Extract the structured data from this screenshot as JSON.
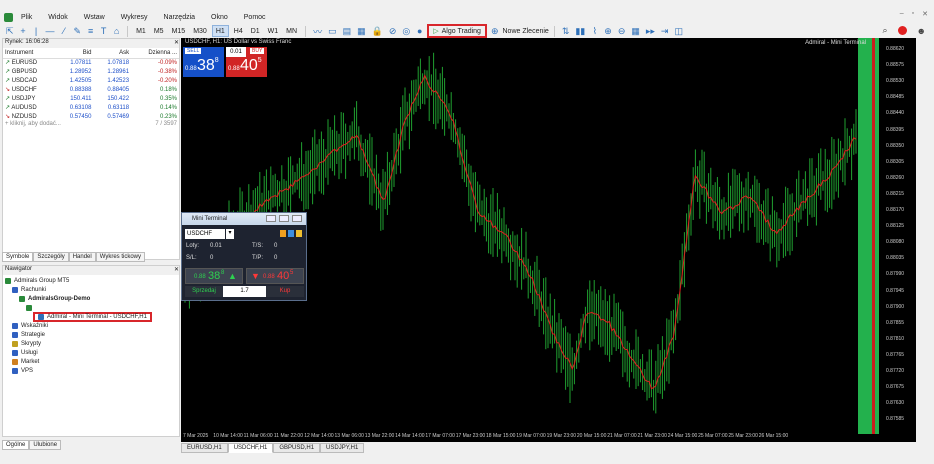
{
  "menu": [
    "Plik",
    "Widok",
    "Wstaw",
    "Wykresy",
    "Narzędzia",
    "Okno",
    "Pomoc"
  ],
  "window_controls": [
    "‒",
    "▫",
    "✕"
  ],
  "toolbar": {
    "timeframes": [
      "M1",
      "M5",
      "M15",
      "M30",
      "H1",
      "H4",
      "D1",
      "W1",
      "MN"
    ],
    "active_tf": "H1",
    "algo_label": "Algo Trading",
    "new_order_label": "Nowe Zlecenie"
  },
  "market_watch": {
    "title": "Rynek: 16:06:28",
    "columns": [
      "Instrument",
      "Bid",
      "Ask",
      "Dzienna ..."
    ],
    "rows": [
      {
        "symbol": "EURUSD",
        "bid": "1.07811",
        "ask": "1.07818",
        "change": "-0.09%",
        "dir": "up"
      },
      {
        "symbol": "GBPUSD",
        "bid": "1.28952",
        "ask": "1.28961",
        "change": "-0.38%",
        "dir": "up"
      },
      {
        "symbol": "USDCAD",
        "bid": "1.42505",
        "ask": "1.42523",
        "change": "-0.20%",
        "dir": "up"
      },
      {
        "symbol": "USDCHF",
        "bid": "0.88388",
        "ask": "0.88405",
        "change": "0.18%",
        "dir": "dn"
      },
      {
        "symbol": "USDJPY",
        "bid": "150.411",
        "ask": "150.422",
        "change": "0.35%",
        "dir": "up"
      },
      {
        "symbol": "AUDUSD",
        "bid": "0.63108",
        "ask": "0.63118",
        "change": "0.14%",
        "dir": "up"
      },
      {
        "symbol": "NZDUSD",
        "bid": "0.57450",
        "ask": "0.57469",
        "change": "0.23%",
        "dir": "dn"
      }
    ],
    "add_row": "+ kliknij, aby dodać...",
    "count": "7 / 3597",
    "tabs": [
      "Symbole",
      "Szczegóły",
      "Handel",
      "Wykres tickowy"
    ]
  },
  "navigator": {
    "title": "Nawigator",
    "items": [
      {
        "label": "Admirals Group MT5",
        "indent": 0,
        "icon": "mt5-icon",
        "color": "#2a8a3a"
      },
      {
        "label": "Rachunki",
        "indent": 1,
        "icon": "accounts-icon",
        "color": "#3060c0"
      },
      {
        "label": "AdmiralsGroup-Demo",
        "indent": 2,
        "icon": "server-icon",
        "color": "#2a8a3a",
        "bold": true
      },
      {
        "label": "",
        "indent": 3,
        "icon": "account-icon",
        "color": "#2a8a3a"
      },
      {
        "label": "Admiral - Mini Terminal - USDCHF,H1",
        "indent": 4,
        "icon": "ea-icon",
        "color": "#2d6fb8",
        "highlight": true
      },
      {
        "label": "Wskaźniki",
        "indent": 1,
        "icon": "indicators-icon",
        "color": "#3060c0"
      },
      {
        "label": "Strategie",
        "indent": 1,
        "icon": "strategies-icon",
        "color": "#3060c0"
      },
      {
        "label": "Skrypty",
        "indent": 1,
        "icon": "scripts-icon",
        "color": "#c0a020"
      },
      {
        "label": "Usługi",
        "indent": 1,
        "icon": "services-icon",
        "color": "#3060c0"
      },
      {
        "label": "Market",
        "indent": 1,
        "icon": "market-icon",
        "color": "#d08020"
      },
      {
        "label": "VPS",
        "indent": 1,
        "icon": "vps-icon",
        "color": "#3060c0"
      }
    ],
    "tabs": [
      "Ogólne",
      "Ulubione"
    ]
  },
  "chart": {
    "header": "USDCHF, H1:  US Dollar vs Swiss Franc",
    "top_right": "Admiral - Mini Terminal",
    "sell": {
      "label": "SELL",
      "small": "0.88",
      "big": "38",
      "sup": "8"
    },
    "buy": {
      "label": "BUY",
      "small": "0.88",
      "big": "40",
      "sup": "5"
    },
    "lot": "0.01",
    "y_ticks": [
      "0.88620",
      "0.88575",
      "0.88530",
      "0.88485",
      "0.88440",
      "0.88395",
      "0.88350",
      "0.88305",
      "0.88260",
      "0.88215",
      "0.88170",
      "0.88125",
      "0.88080",
      "0.88035",
      "0.87990",
      "0.87945",
      "0.87900",
      "0.87855",
      "0.87810",
      "0.87765",
      "0.87720",
      "0.87675",
      "0.87630",
      "0.87585"
    ],
    "x_ticks": [
      "7 Mar 2025",
      "10 Mar 14:00",
      "11 Mar 06:00",
      "11 Mar 22:00",
      "12 Mar 14:00",
      "13 Mar 06:00",
      "13 Mar 22:00",
      "14 Mar 14:00",
      "17 Mar 07:00",
      "17 Mar 23:00",
      "18 Mar 15:00",
      "19 Mar 07:00",
      "19 Mar 23:00",
      "20 Mar 15:00",
      "21 Mar 07:00",
      "21 Mar 23:00",
      "24 Mar 15:00",
      "25 Mar 07:00",
      "25 Mar 23:00",
      "26 Mar 15:00"
    ],
    "tabs": [
      "EURUSD,H1",
      "USDCHF,H1",
      "GBPUSD,H1",
      "USDJPY,H1"
    ],
    "active_tab": "USDCHF,H1"
  },
  "mini_terminal": {
    "title": "Mini Terminal",
    "symbol": "USDCHF",
    "lots_label": "Loty:",
    "lots": "0.01",
    "sl_label": "S/L:",
    "sl": "0",
    "ts_label": "T/S:",
    "ts": "0",
    "tp_label": "T/P:",
    "tp": "0",
    "sell_price_small": "0.88",
    "sell_price_big": "38",
    "sell_price_sup": "8",
    "buy_price_small": "0.88",
    "buy_price_big": "40",
    "buy_price_sup": "5",
    "sell_label": "Sprzedaj",
    "quantity": "1.7",
    "buy_label": "Kup"
  }
}
